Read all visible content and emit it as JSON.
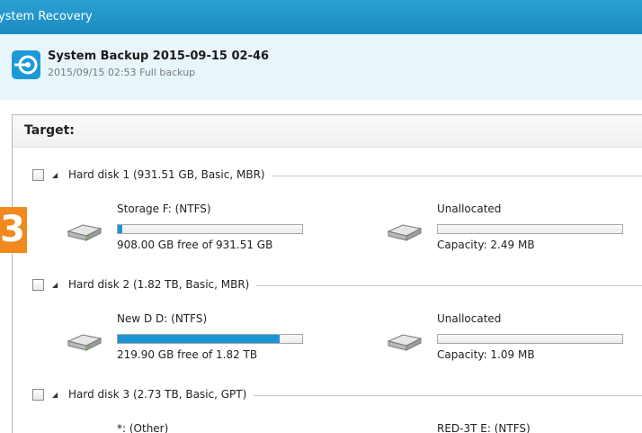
{
  "window": {
    "title": "ystem Recovery"
  },
  "backup": {
    "title": "System Backup 2015-09-15 02-46",
    "subtitle": "2015/09/15 02:53 Full backup"
  },
  "target": {
    "label": "Target:"
  },
  "side_tab": {
    "label": "3"
  },
  "disks": [
    {
      "label": "Hard disk 1 (931.51 GB, Basic, MBR)",
      "partitions": [
        {
          "name": "Storage F: (NTFS)",
          "info": "908.00 GB free of 931.51 GB",
          "used_fraction": 0.025
        },
        {
          "name": "Unallocated",
          "info": "Capacity: 2.49 MB",
          "used_fraction": 0
        }
      ]
    },
    {
      "label": "Hard disk 2 (1.82 TB, Basic, MBR)",
      "partitions": [
        {
          "name": "New D D: (NTFS)",
          "info": "219.90 GB free of 1.82 TB",
          "used_fraction": 0.88
        },
        {
          "name": "Unallocated",
          "info": "Capacity: 1.09 MB",
          "used_fraction": 0
        }
      ]
    },
    {
      "label": "Hard disk 3 (2.73 TB, Basic, GPT)",
      "partitions": [
        {
          "name": "*: (Other)"
        },
        {
          "name": "RED-3T E: (NTFS)"
        }
      ]
    }
  ],
  "colors": {
    "accent": "#1a94d2",
    "title_bar": "#1b8cc2",
    "header_bg": "#e8f5fb",
    "side_tab": "#f08a1e"
  }
}
